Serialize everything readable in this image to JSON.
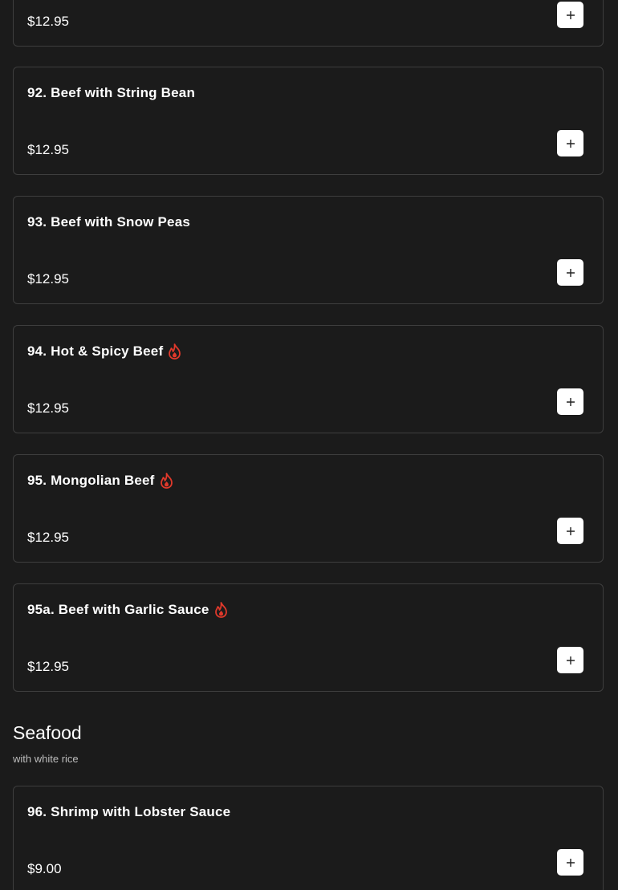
{
  "items": [
    {
      "name": "",
      "price": "$12.95",
      "spicy": false
    },
    {
      "name": "92. Beef with String Bean",
      "price": "$12.95",
      "spicy": false
    },
    {
      "name": "93. Beef with Snow Peas",
      "price": "$12.95",
      "spicy": false
    },
    {
      "name": "94. Hot & Spicy Beef",
      "price": "$12.95",
      "spicy": true
    },
    {
      "name": "95. Mongolian Beef",
      "price": "$12.95",
      "spicy": true
    },
    {
      "name": "95a. Beef with Garlic Sauce",
      "price": "$12.95",
      "spicy": true
    }
  ],
  "seafood": {
    "title": "Seafood",
    "subtitle": "with white rice",
    "items": [
      {
        "name": "96. Shrimp with Lobster Sauce",
        "price": "$9.00",
        "spicy": false
      }
    ]
  },
  "icons": {
    "add": "plus-icon",
    "spicy": "flame-icon"
  },
  "colors": {
    "background": "#1b1b1b",
    "card_border": "#3e3e3e",
    "text": "#ffffff",
    "spicy": "#e0392b",
    "add_button": "#ffffff"
  }
}
